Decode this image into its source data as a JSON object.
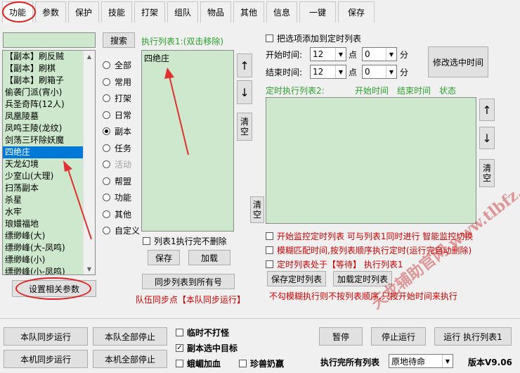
{
  "tabs": [
    "功能",
    "参数",
    "保护",
    "技能",
    "打架",
    "组队",
    "物品",
    "其他",
    "信息",
    "一键",
    "保存"
  ],
  "search": {
    "button": "搜索",
    "value": ""
  },
  "dungeon_list": [
    {
      "label": "【副本】刷反贼",
      "color": "#000"
    },
    {
      "label": "【副本】刷棋",
      "color": "#000"
    },
    {
      "label": "【副本】刷箱子",
      "color": "#000"
    },
    {
      "label": "偷袭门派(宵小)",
      "color": "#000"
    },
    {
      "label": "兵圣奇阵(12人)",
      "color": "#000"
    },
    {
      "label": "凤凰陵墓",
      "color": "#000"
    },
    {
      "label": "凤鸣王陵(龙纹)",
      "color": "#000"
    },
    {
      "label": "剑荡三环除妖魔",
      "color": "#000"
    },
    {
      "label": "四绝庄",
      "color": "#fff",
      "selected": true
    },
    {
      "label": "天龙幻境",
      "color": "#000"
    },
    {
      "label": "少室山(大理)",
      "color": "#000"
    },
    {
      "label": "扫荡副本",
      "color": "#000"
    },
    {
      "label": "杀星",
      "color": "#000"
    },
    {
      "label": "水牢",
      "color": "#000"
    },
    {
      "label": "琅嬛福地",
      "color": "#000"
    },
    {
      "label": "缥缈峰(大)",
      "color": "#000"
    },
    {
      "label": "缥缈峰(大-凤鸣)",
      "color": "#000"
    },
    {
      "label": "缥缈峰(小)",
      "color": "#000"
    },
    {
      "label": "缥缈峰(小-凤鸣)",
      "color": "#000"
    }
  ],
  "settings_button": "设置相关参数",
  "categories": [
    {
      "label": "全部",
      "checked": false,
      "disabled": false
    },
    {
      "label": "常用",
      "checked": false,
      "disabled": false
    },
    {
      "label": "打架",
      "checked": false,
      "disabled": false
    },
    {
      "label": "日常",
      "checked": false,
      "disabled": false
    },
    {
      "label": "副本",
      "checked": true,
      "disabled": false
    },
    {
      "label": "任务",
      "checked": false,
      "disabled": false
    },
    {
      "label": "活动",
      "checked": false,
      "disabled": true
    },
    {
      "label": "帮盟",
      "checked": false,
      "disabled": false
    },
    {
      "label": "功能",
      "checked": false,
      "disabled": false
    },
    {
      "label": "其他",
      "checked": false,
      "disabled": false
    },
    {
      "label": "自定义",
      "checked": false,
      "disabled": false
    }
  ],
  "exec_list1": {
    "title": "执行列表1:(双击移除)",
    "items": [
      "四绝庄"
    ]
  },
  "up_arrow": "↑",
  "down_arrow": "↓",
  "clear": "清空",
  "no_delete_checkbox": "列表1执行完不删除",
  "save_button": "保存",
  "load_button": "加载",
  "sync_button": "同步列表到所有号",
  "sync_hint": "队伍同步点【本队同步运行】",
  "add_timed_checkbox": "把选项添加到定时列表",
  "start_label": "开始时间:",
  "end_label": "结束时间:",
  "hour_unit": "点",
  "minute_unit": "分",
  "start_hour": "12",
  "start_min": "0",
  "end_hour": "12",
  "end_min": "0",
  "modify_time_button": "修改选中时间",
  "timed_list": {
    "title": "定时执行列表2:",
    "col_start": "开始时间",
    "col_end": "结束时间",
    "col_status": "状态"
  },
  "monitor_checkbox": "开始监控定时列表 可与列表1同时进行 智能监控切换",
  "fuzzy_checkbox": "模糊匹配时间,按列表顺序执行定时(运行完自动删除)",
  "wait_checkbox": "定时列表处于【等待】 执行列表1",
  "save_timed_button": "保存定时列表",
  "load_timed_button": "加载定时列表",
  "timed_hint": "不勾模糊执行则不按列表顺序,只按开始时间来执行",
  "bottom": {
    "team_sync_run": "本队同步运行",
    "team_stop_all": "本队全部停止",
    "local_sync_run": "本机同步运行",
    "local_stop_all": "本机全部停止",
    "cb_no_fight": "临时不打怪",
    "cb_target": "副本选中目标",
    "cb_heal": "蛾嵋加血",
    "cb_pet": "珍兽奶嬴",
    "pause": "暂停",
    "stop": "停止运行",
    "run": "运行 执行列表1",
    "after_label": "执行完所有列表",
    "after_value": "原地待命",
    "version": "版本V9.06"
  },
  "watermark": "天龙辅助官网 www.tlbfz.com"
}
